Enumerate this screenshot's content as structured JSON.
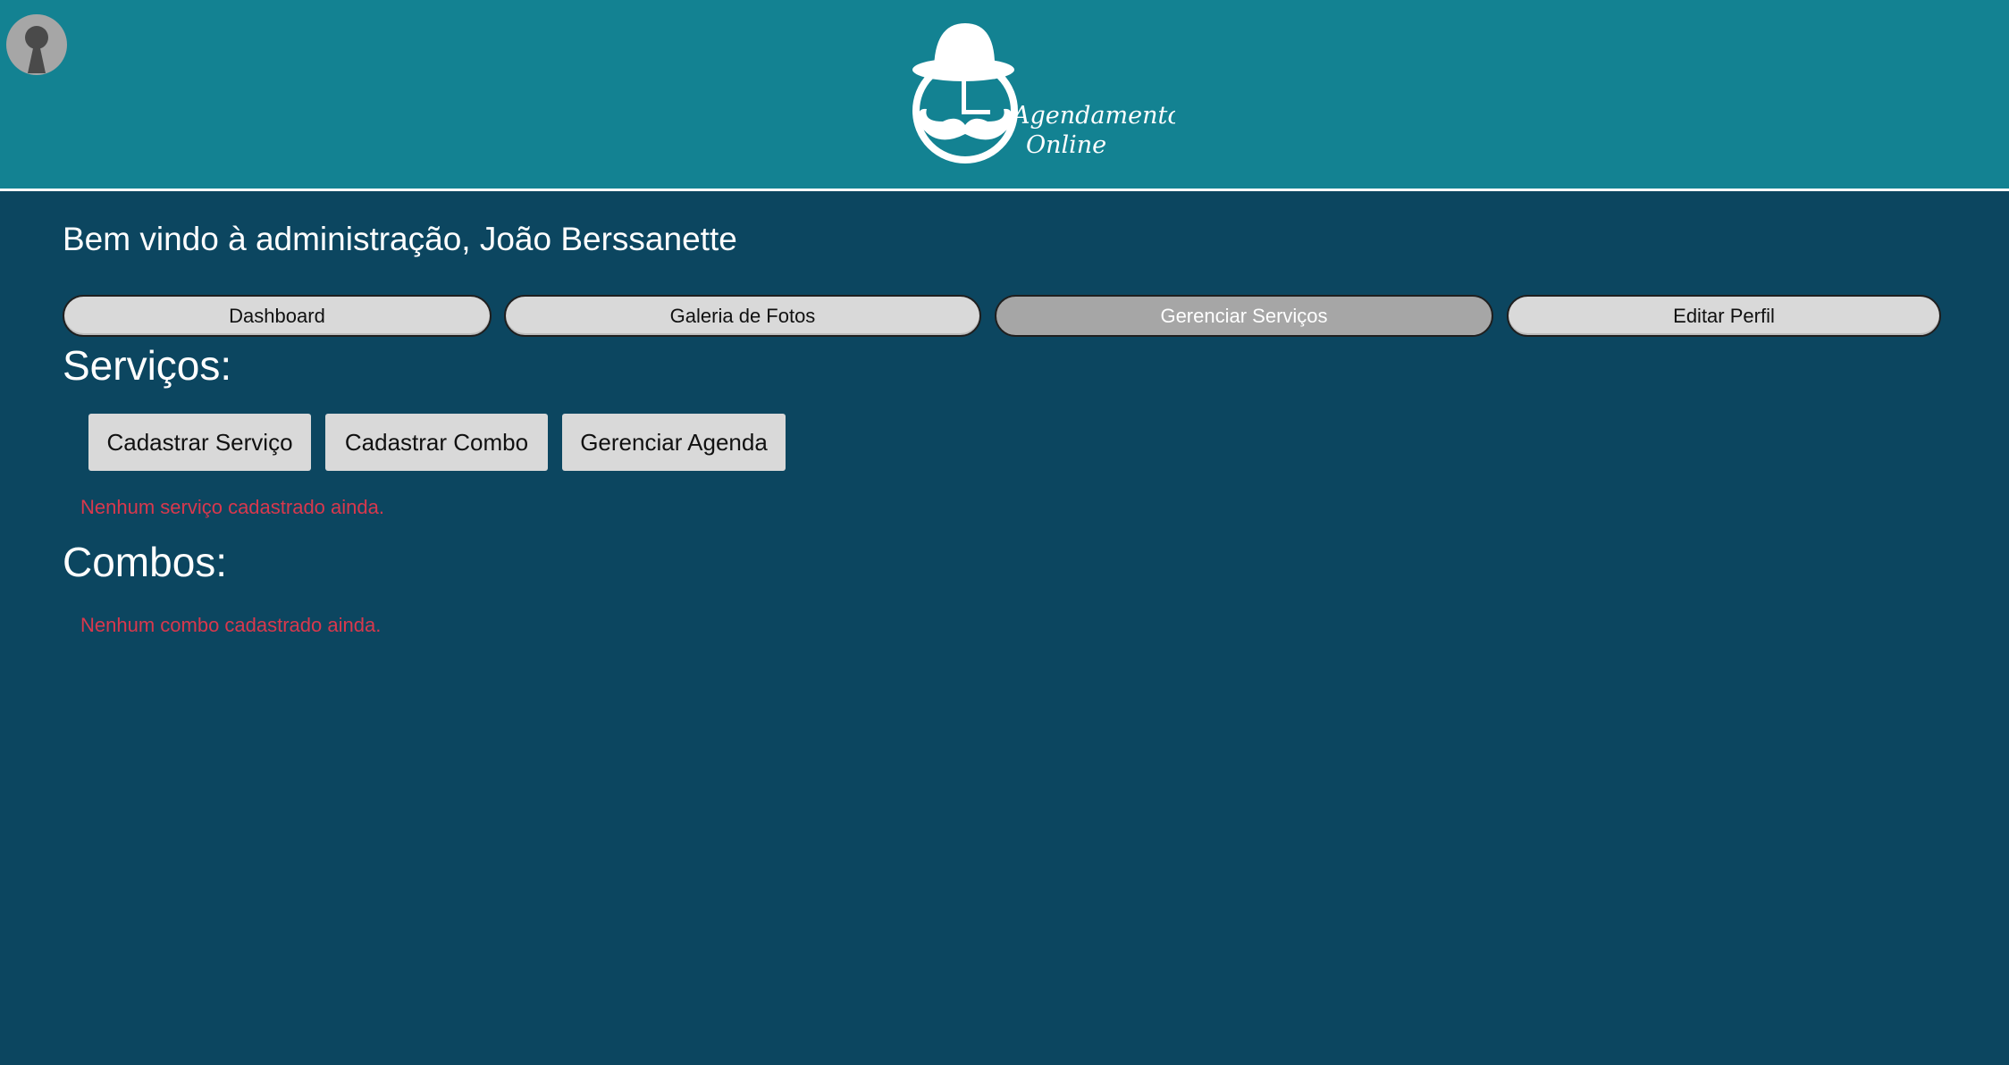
{
  "header": {
    "logo_text_line1": "Agendamento",
    "logo_text_line2": "Online",
    "avatar_icon": "user-avatar-icon",
    "logo_icon": "gentleman-bowler-hat-mustache-icon"
  },
  "main": {
    "welcome": "Bem vindo à administração, João Berssanette",
    "tabs": [
      {
        "label": "Dashboard",
        "active": false
      },
      {
        "label": "Galeria de Fotos",
        "active": false
      },
      {
        "label": "Gerenciar Serviços",
        "active": true
      },
      {
        "label": "Editar Perfil",
        "active": false
      }
    ],
    "services": {
      "title": "Serviços:",
      "actions": [
        "Cadastrar Serviço",
        "Cadastrar Combo",
        "Gerenciar Agenda"
      ],
      "empty_message": "Nenhum serviço cadastrado ainda."
    },
    "combos": {
      "title": "Combos:",
      "empty_message": "Nenhum combo cadastrado ainda."
    }
  },
  "colors": {
    "header_bg": "#138292",
    "main_bg": "#0c4660",
    "tab_bg": "#d9d9d9",
    "tab_active_bg": "#a6a6a6",
    "error_text": "#d9384d"
  }
}
